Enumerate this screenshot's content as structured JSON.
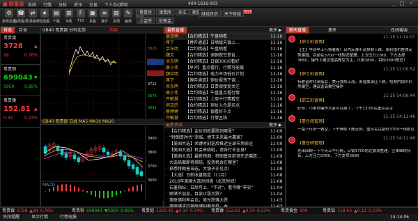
{
  "app": {
    "logo": "■ 财富通",
    "phone": "400-1616-003"
  },
  "menu": [
    "系统",
    "行情",
    "分析",
    "资讯",
    "交易",
    "个人中心",
    "帮助"
  ],
  "toolbar": [
    {
      "label": "系统设置",
      "icon": "⚙"
    },
    {
      "label": "在线客户",
      "icon": "☎"
    },
    {
      "label": "交易系统",
      "icon": "⇄"
    },
    {
      "label": "自选股",
      "icon": "★"
    },
    {
      "label": "个股",
      "icon": "▤"
    },
    {
      "label": "K线",
      "icon": "▥"
    },
    {
      "label": "F10",
      "icon": "F"
    },
    {
      "label": "多股",
      "icon": "▦"
    },
    {
      "label": "排行",
      "icon": "≡"
    },
    {
      "label": "多周",
      "icon": "▧"
    },
    {
      "label": "画线",
      "icon": "✎"
    },
    {
      "label": "技术",
      "icon": "∿"
    },
    {
      "label": "手机",
      "icon": "▯"
    },
    {
      "label": "天下财经",
      "icon": "◉"
    },
    {
      "label": "事件",
      "icon": "!"
    },
    {
      "label": "小",
      "icon": "—"
    },
    {
      "label": "关",
      "icon": "×"
    }
  ],
  "markets": [
    [
      "粤贵所",
      "上金所"
    ],
    [
      "津贵所",
      "伦敦金"
    ],
    [
      "外汇"
    ],
    [
      "期货"
    ]
  ],
  "toolbar_right": {
    "btn1": "财经日历",
    "btn2": "天下财经",
    "badge": "HOT"
  },
  "left_tabs": [
    "自选",
    "目录"
  ],
  "indices": [
    {
      "name": "粤贵银",
      "price": "3728",
      "arrow": "▲",
      "chg": "28",
      "pct": "0.76%",
      "dir": "up"
    },
    {
      "name": "粤贵铜",
      "price": "699043",
      "arrow": "▼",
      "chg": "5950",
      "pct": "0.85%",
      "dir": "dn"
    },
    {
      "name": "粤贵镍",
      "price": "152.81",
      "arrow": "▲",
      "chg": "0.34",
      "pct": "0.23%",
      "dir": "up"
    }
  ],
  "chart_tabs": {
    "t1": "分时",
    "t2": "K线",
    "chart_title": "GB40 粤贵银 分时走势",
    "label1": "均线",
    "label2": "MACD"
  },
  "kline_header": "GB40 粤贵银 日线 MA5 MA10 MA20",
  "price_axis": [
    "3826",
    "3789",
    "3752",
    "3715",
    "3678",
    "3641"
  ],
  "price_axis2": [
    "3900",
    "3800",
    "3700",
    "3600"
  ],
  "volume_label": "成交量",
  "middle_panel": {
    "tab1": "最新直播",
    "tab2": "更多 ▶",
    "tab3": "最新资讯",
    "tab4": "更多 ▶"
  },
  "live_news": [
    {
      "src": "余东明",
      "text": "【合约精选】午盘稍看",
      "time": "11-16"
    },
    {
      "src": "蒋下",
      "text": "【博弈通道】日晒银天银上…",
      "time": "11-16"
    },
    {
      "src": "余东明",
      "text": "【合约精选】午盘稍看",
      "time": "11-16"
    },
    {
      "src": "魏文",
      "text": "【合约精选】调铜做空意旨…",
      "time": "11-16"
    },
    {
      "src": "余东明",
      "text": "【合约精选】日银300点看好",
      "time": "11-16"
    },
    {
      "src": "黄小伟",
      "text": "【早评】重点看行，行情可能做",
      "time": "11-16"
    },
    {
      "src": "魏中明",
      "text": "【合约精选】电力市场低价计划",
      "time": "11-16"
    },
    {
      "src": "蒋下",
      "text": "【博弈通道】铜价震荡下调…",
      "time": "11-16"
    },
    {
      "src": "余东明",
      "text": "【合约精选】日贵银接受关注",
      "time": "11-16"
    },
    {
      "src": "黄小伟",
      "text": "【合约精选】午盘重点看行情",
      "time": "11-16"
    },
    {
      "src": "齐敏慧",
      "text": "【合约精选】上周十行情看空",
      "time": "11-16"
    },
    {
      "src": "何文的",
      "text": "【合约精选】铜价入仓是买点",
      "time": "11-16"
    },
    {
      "src": "蔡婷婷",
      "text": "【合约精选】银看好千点",
      "time": "11-16"
    },
    {
      "src": "齐敏慧",
      "text": "【合约精选】行情主线",
      "time": "11-16"
    }
  ],
  "info_news": [
    {
      "text": "【合约精选】金价到底要跌到哪里？",
      "time": "11-09"
    },
    {
      "text": "“特朗普时代”来临，债市未来最大赢家？",
      "time": "11-09"
    },
    {
      "text": "【美国大选】关键时刻逆后推迟全球市场命运",
      "time": "11-09"
    },
    {
      "text": "【美国大选】机会来临啦，请各行业全身！",
      "time": "11-09"
    },
    {
      "text": "【美国大选】最新预测：特朗普目前领先逆袭跌…",
      "time": "11-09"
    },
    {
      "text": "大选局面即将揭晓，投资机会在哪里？",
      "time": "11-08"
    },
    {
      "text": "获悉特朗普当选，大银子亦见点！",
      "time": "11-08"
    },
    {
      "text": "【大选】日前收盘稳定（11月）",
      "time": "11-08"
    },
    {
      "text": "2016年美国大选时间表（北京时间）",
      "time": "11-08"
    },
    {
      "text": "石墨指标：日后可上，“不对”，看今晚“非农”",
      "time": "11-04"
    },
    {
      "text": "联储不加息，目欲止涨大跌？",
      "time": "11-04"
    },
    {
      "text": "美联储利率会议，美元跌落大跌",
      "time": "11-03"
    },
    {
      "text": "美联储进行美联储利率走低。本…",
      "time": "11-03"
    }
  ],
  "chat": {
    "tab1": "聊天直播",
    "tab2": "更多",
    "tab3": "在线客服",
    "messages": [
      {
        "name": "【职工彩银博】",
        "time": "11-15 11:14:07",
        "text": "【主】早间早上行情看看！日内反弹不及预期下跌，周初银价整体走势偏弱，目前在3700一线附近整理，上方压力3780，下方支撑3680，操作上建议逢高做空为主，止损3800，目标3680附近！"
      },
      {
        "name": "【职工彩银博】",
        "time": "11-15 12:00:52",
        "text": "特朗普时代来临后，美元强势上涨，贵金属承压下跌，短期内银价仍然偏空，建议逢高做空操作"
      },
      {
        "name": "【职工彩银博】",
        "time": "11-15 14:06:44",
        "text": "好呀，小老师操作大家可以跟了，下午13:00后重点关注"
      },
      {
        "name": "【董仓硕管理】",
        "time": "11-15 14:11:46",
        "text": "一路下行多一做空，下午继续下跌走势，重点关注银价3700一线附近"
      },
      {
        "name": "【董仓硕管理】",
        "time": "11-15 14:11:46",
        "text": "先来回顾一下今天上午行情，日银3700附近震荡整理，空单继续持有，上方压力3780，下方支撑3680"
      }
    ]
  },
  "statusbar": [
    {
      "name": "粤贵银",
      "val": "3728",
      "chg": "▲28",
      "pct": "0.76%",
      "dir": "up"
    },
    {
      "name": "粤贵铜",
      "val": "699043",
      "chg": "▼5950",
      "pct": "0.85%",
      "dir": "dn"
    },
    {
      "name": "粤贵钯",
      "val": "1225.45",
      "chg": "▲4.10",
      "pct": "0.34%",
      "dir": "up"
    },
    {
      "name": "粤贵镍",
      "val": "152.81",
      "chg": "▲0.34",
      "pct": "0.23%",
      "dir": "up"
    },
    {
      "name": "粤贵黄金",
      "val": "300",
      "chg": "",
      "pct": "",
      "dir": "up"
    },
    {
      "name": "粤贵铂",
      "val": "318.63",
      "chg": "▲0.12",
      "pct": "0.23%",
      "dir": "up"
    }
  ],
  "bottom": {
    "a": "关闭提醒",
    "b": "显示行情",
    "c": "行情电报",
    "time": "14:14:06"
  }
}
